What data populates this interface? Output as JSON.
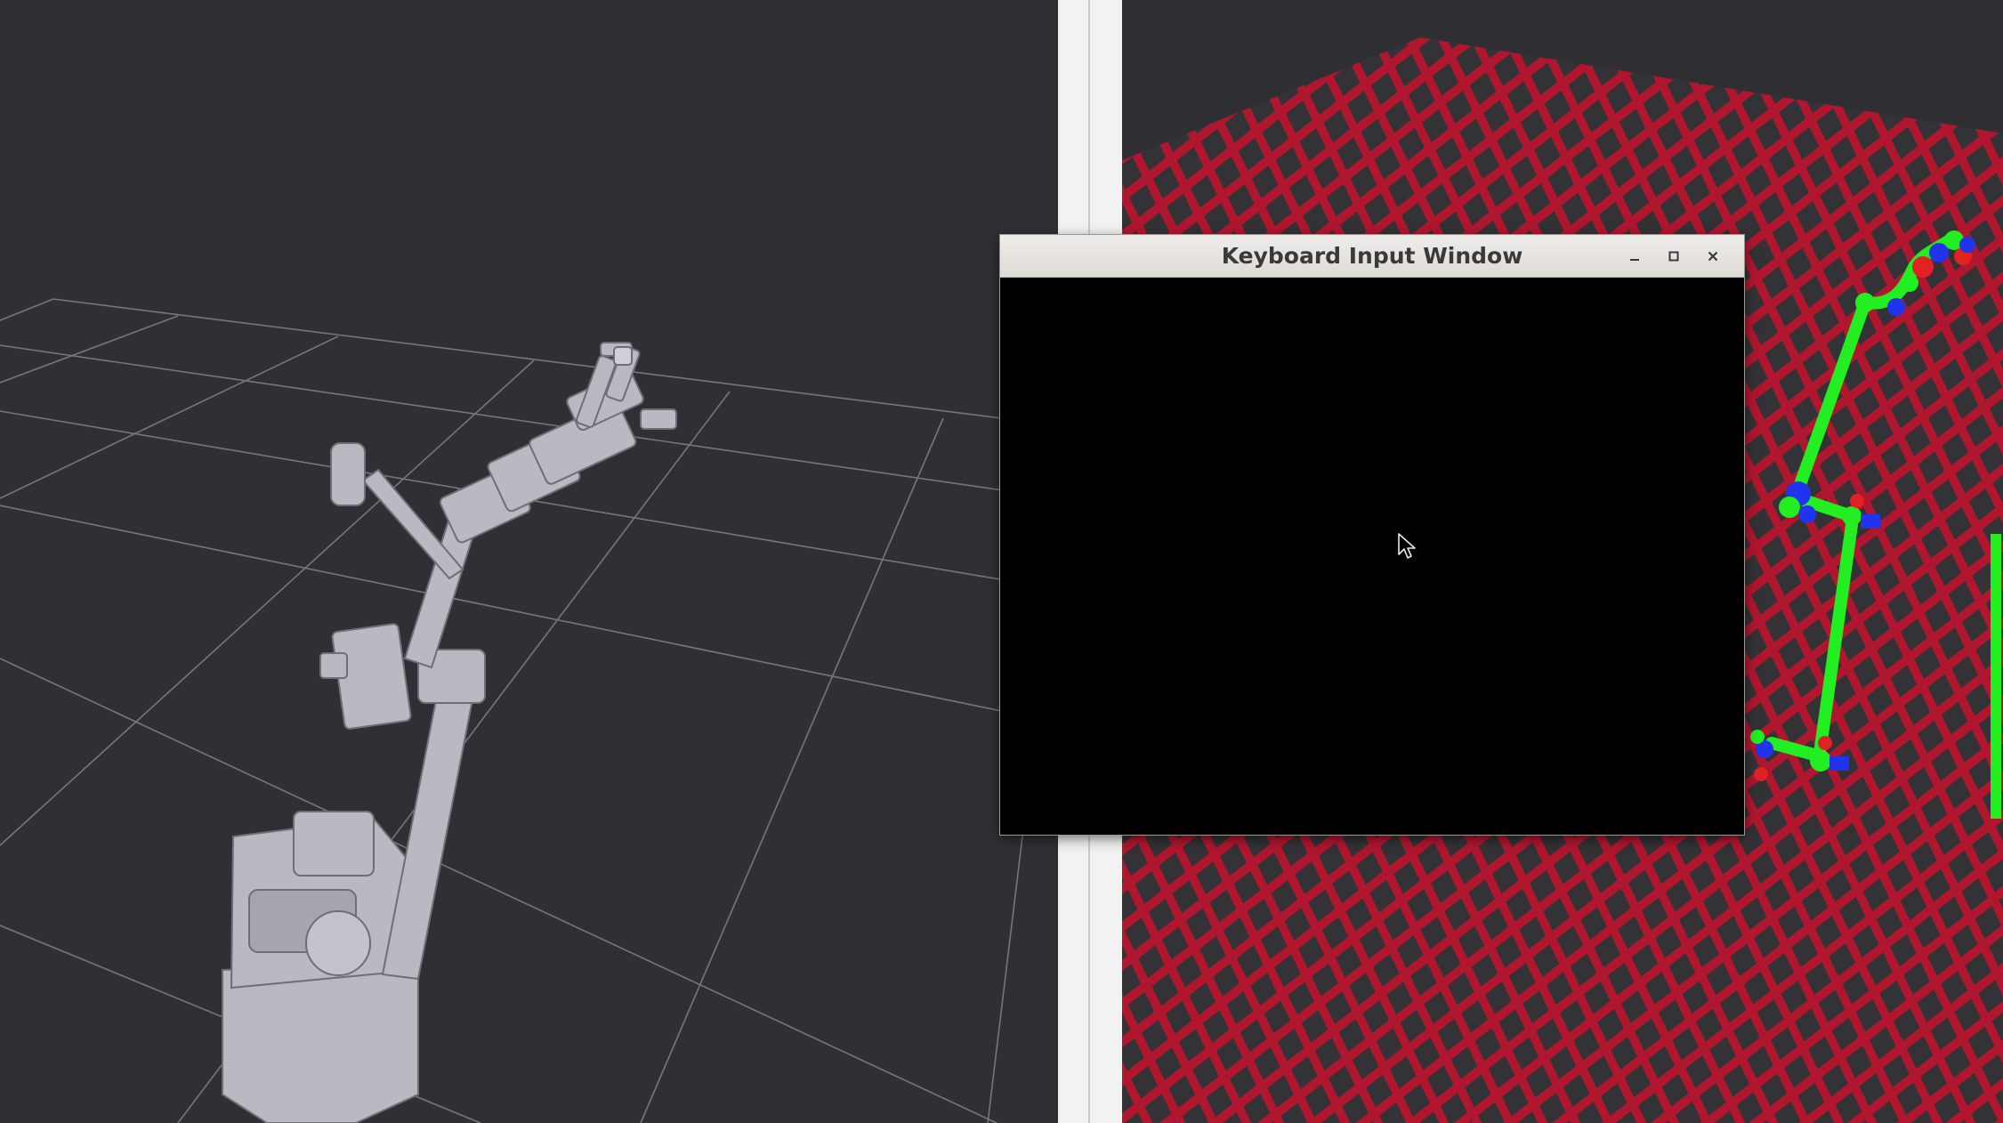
{
  "windows": {
    "keyboard_input": {
      "title": "Keyboard Input Window",
      "controls": {
        "minimize_icon": "minimize-icon",
        "maximize_icon": "maximize-icon",
        "close_icon": "close-icon"
      }
    }
  },
  "viewports": {
    "left": {
      "icon": "robot-arm-model",
      "background": "#302f34",
      "grid_color": "#7a797e"
    },
    "right": {
      "icon": "robot-arm-skeleton",
      "floor_color": "#b0162e",
      "link_color": "#22ee22"
    }
  },
  "cursor_icon": "mouse-pointer-icon"
}
